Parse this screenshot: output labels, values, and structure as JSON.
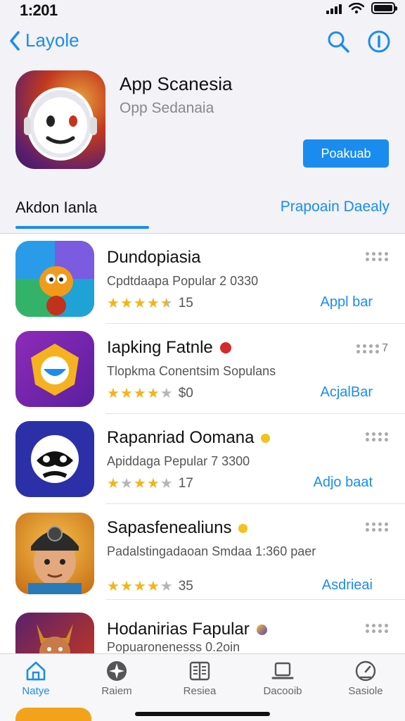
{
  "status_bar": {
    "time": "1:201"
  },
  "nav": {
    "back_label": "Layole"
  },
  "app": {
    "title": "App Scanesia",
    "subtitle": "Opp Sedanaia",
    "get_label": "Poakuab"
  },
  "tabs": {
    "left_label": "Akdon Ianla",
    "right_label": "Prapoain Daealy"
  },
  "list": [
    {
      "title": "Dundopiasia",
      "subtitle": "Cpdtdaapa Popular 2 0330",
      "rating_text": "15",
      "rating": 4.5,
      "more_label": "",
      "action": "Appl bar",
      "badge": ""
    },
    {
      "title": "Iapking Fatnle",
      "subtitle": "Tlopkma Conentsim Sopulans",
      "rating_text": "$0",
      "rating": 4,
      "more_label": "7",
      "action": "AcjalBar",
      "badge": "red"
    },
    {
      "title": "Rapanriad Oomana",
      "subtitle": "Apiddaga Pepular 7 3300",
      "rating_text": "17",
      "rating": 4,
      "more_label": "",
      "action": "Adjo baat",
      "badge": "gold"
    },
    {
      "title": "Sapasfenealiuns",
      "subtitle": "Padalstingadaoan Smdaa 1:360 paer",
      "rating_text": "35",
      "rating": 4,
      "more_label": "",
      "action": "Asdrieai",
      "badge": "gold"
    },
    {
      "title": "Hodanirias Fapular",
      "subtitle": "Popuaronenesss 0.2oin",
      "rating_text": "",
      "rating": 0,
      "more_label": "",
      "action": "",
      "badge": "purple"
    }
  ],
  "tabbar": [
    {
      "label": "Natye",
      "icon": "home-icon",
      "active": true
    },
    {
      "label": "Raiem",
      "icon": "compass-icon",
      "active": false
    },
    {
      "label": "Resiea",
      "icon": "book-icon",
      "active": false
    },
    {
      "label": "Dacooib",
      "icon": "laptop-icon",
      "active": false
    },
    {
      "label": "Sasiole",
      "icon": "gauge-icon",
      "active": false
    }
  ],
  "colors": {
    "accent": "#1a8cf0",
    "star": "#f3b41b",
    "background": "#f2f2f7"
  }
}
